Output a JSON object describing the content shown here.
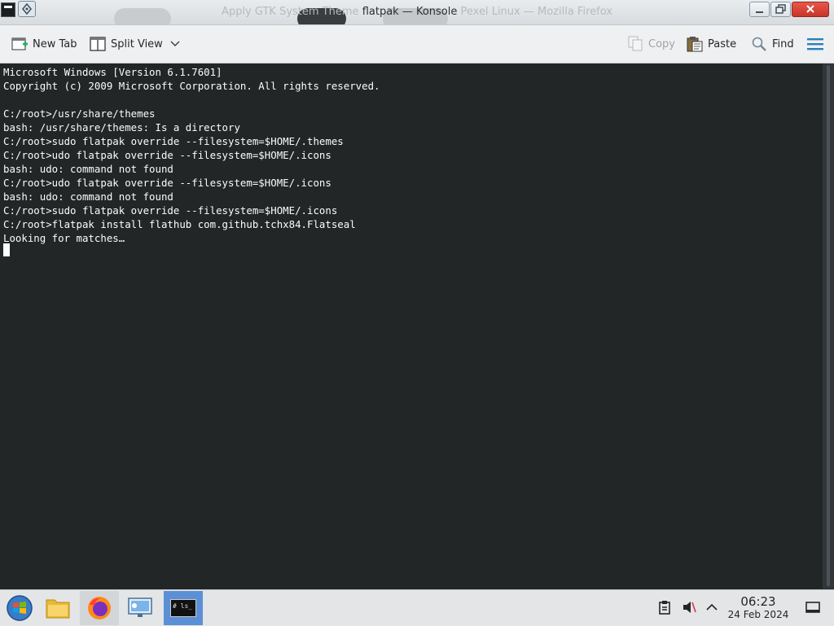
{
  "window": {
    "title": "flatpak — Konsole",
    "background_title_left": "Apply GTK System Theme",
    "background_title_mid": "Pexel",
    "background_title_right": "Linux — Mozilla Firefox"
  },
  "toolbar": {
    "new_tab": "New Tab",
    "split_view": "Split View",
    "copy": "Copy",
    "paste": "Paste",
    "find": "Find"
  },
  "terminal": {
    "lines": [
      "Microsoft Windows [Version 6.1.7601]",
      "Copyright (c) 2009 Microsoft Corporation. All rights reserved.",
      "",
      "C:/root>/usr/share/themes",
      "bash: /usr/share/themes: Is a directory",
      "C:/root>sudo flatpak override --filesystem=$HOME/.themes",
      "C:/root>udo flatpak override --filesystem=$HOME/.icons",
      "bash: udo: command not found",
      "C:/root>udo flatpak override --filesystem=$HOME/.icons",
      "bash: udo: command not found",
      "C:/root>sudo flatpak override --filesystem=$HOME/.icons",
      "C:/root>flatpak install flathub com.github.tchx84.Flatseal",
      "Looking for matches…"
    ]
  },
  "taskbar": {
    "items": [
      "start-menu",
      "file-manager",
      "firefox",
      "system-settings",
      "konsole"
    ],
    "konsole_label": "# ls_",
    "time": "06:23",
    "date": "24 Feb 2024"
  },
  "colors": {
    "terminal_bg": "#232627",
    "terminal_fg": "#fcfcfc",
    "accent": "#3daee9"
  }
}
